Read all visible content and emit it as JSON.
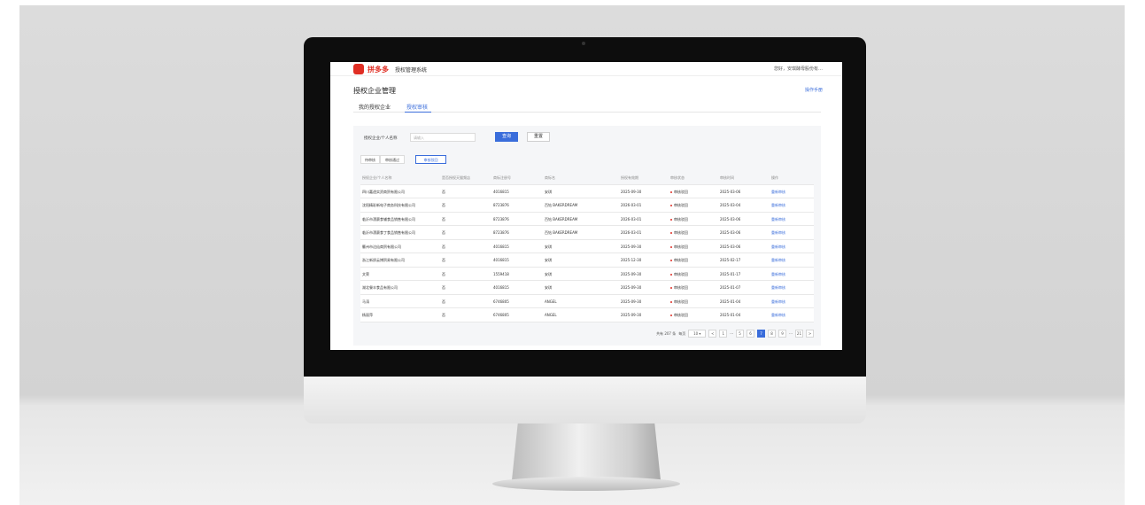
{
  "app": {
    "brand": "拼多多",
    "system_name": "授权管理系统",
    "user_menu": "您好，安琪酵母股份有…"
  },
  "page": {
    "title": "授权企业管理",
    "manual_link": "操作手册"
  },
  "tabs": [
    {
      "label": "我的授权企业",
      "active": false
    },
    {
      "label": "授权审核",
      "active": true
    }
  ],
  "filter": {
    "label": "授权企业/个人名称",
    "placeholder": "请输入",
    "query_button": "查询",
    "reset_button": "重置"
  },
  "status_tabs": [
    {
      "label": "待审核",
      "active": false
    },
    {
      "label": "审核通过",
      "active": false
    },
    {
      "label": "审核驳回",
      "active": true
    }
  ],
  "table": {
    "columns": [
      "授权企业/个人名称",
      "是否授权天猫频店",
      "商标注册号",
      "商标名",
      "授权有效期",
      "审核状态",
      "审核时间",
      "操作"
    ],
    "rows": [
      {
        "name": "四川嘉途实资商贸有限公司",
        "tmall": "否",
        "reg_no": "4016815",
        "brand": "安琪",
        "valid": "2025-09-30",
        "status": "审核驳回",
        "audit_time": "2025-03-06",
        "action": "重新审核"
      },
      {
        "name": "沈阳精彩新电子商务科技有限公司",
        "tmall": "否",
        "reg_no": "8723876",
        "brand": "百钻 BAKERDREAM",
        "valid": "2026-03-01",
        "status": "审核驳回",
        "audit_time": "2025-03-04",
        "action": "重新审核"
      },
      {
        "name": "临沂市漂赛食辅食品销售有限公司",
        "tmall": "否",
        "reg_no": "8723876",
        "brand": "百钻 BAKERDREAM",
        "valid": "2026-03-01",
        "status": "审核驳回",
        "audit_time": "2025-03-06",
        "action": "重新审核"
      },
      {
        "name": "临沂市漂赛食丁食品销售有限公司",
        "tmall": "否",
        "reg_no": "8723876",
        "brand": "百钻 BAKERDREAM",
        "valid": "2026-03-01",
        "status": "审核驳回",
        "audit_time": "2025-03-06",
        "action": "重新审核"
      },
      {
        "name": "衢州市达仙商贸有限公司",
        "tmall": "否",
        "reg_no": "4016815",
        "brand": "安琪",
        "valid": "2025-09-30",
        "status": "审核驳回",
        "audit_time": "2025-03-06",
        "action": "重新审核"
      },
      {
        "name": "浙江新质云博贸易有限公司",
        "tmall": "否",
        "reg_no": "4016815",
        "brand": "安琪",
        "valid": "2025-12-30",
        "status": "审核驳回",
        "audit_time": "2025-02-17",
        "action": "重新审核"
      },
      {
        "name": "文荣",
        "tmall": "否",
        "reg_no": "1559418",
        "brand": "安琪",
        "valid": "2025-09-30",
        "status": "审核驳回",
        "audit_time": "2025-01-17",
        "action": "重新审核"
      },
      {
        "name": "湖北餐丰食品有限公司",
        "tmall": "否",
        "reg_no": "4016815",
        "brand": "安琪",
        "valid": "2025-09-30",
        "status": "审核驳回",
        "audit_time": "2025-01-07",
        "action": "重新审核"
      },
      {
        "name": "马涛",
        "tmall": "否",
        "reg_no": "6746805",
        "brand": "ANGEL",
        "valid": "2025-09-30",
        "status": "审核驳回",
        "audit_time": "2025-01-04",
        "action": "重新审核"
      },
      {
        "name": "杨丽萍",
        "tmall": "否",
        "reg_no": "6746805",
        "brand": "ANGEL",
        "valid": "2025-09-30",
        "status": "审核驳回",
        "audit_time": "2025-01-04",
        "action": "重新审核"
      }
    ]
  },
  "pagination": {
    "total_text": "共有 207 条",
    "per_page_label": "每页",
    "per_page": "10",
    "prev": "<",
    "next": ">",
    "ellipsis": "···",
    "pages": [
      "1",
      "5",
      "6",
      "7",
      "8",
      "9",
      "21"
    ],
    "current": "7"
  },
  "colors": {
    "brand_red": "#e02e24",
    "accent_blue": "#3a6ddb"
  }
}
